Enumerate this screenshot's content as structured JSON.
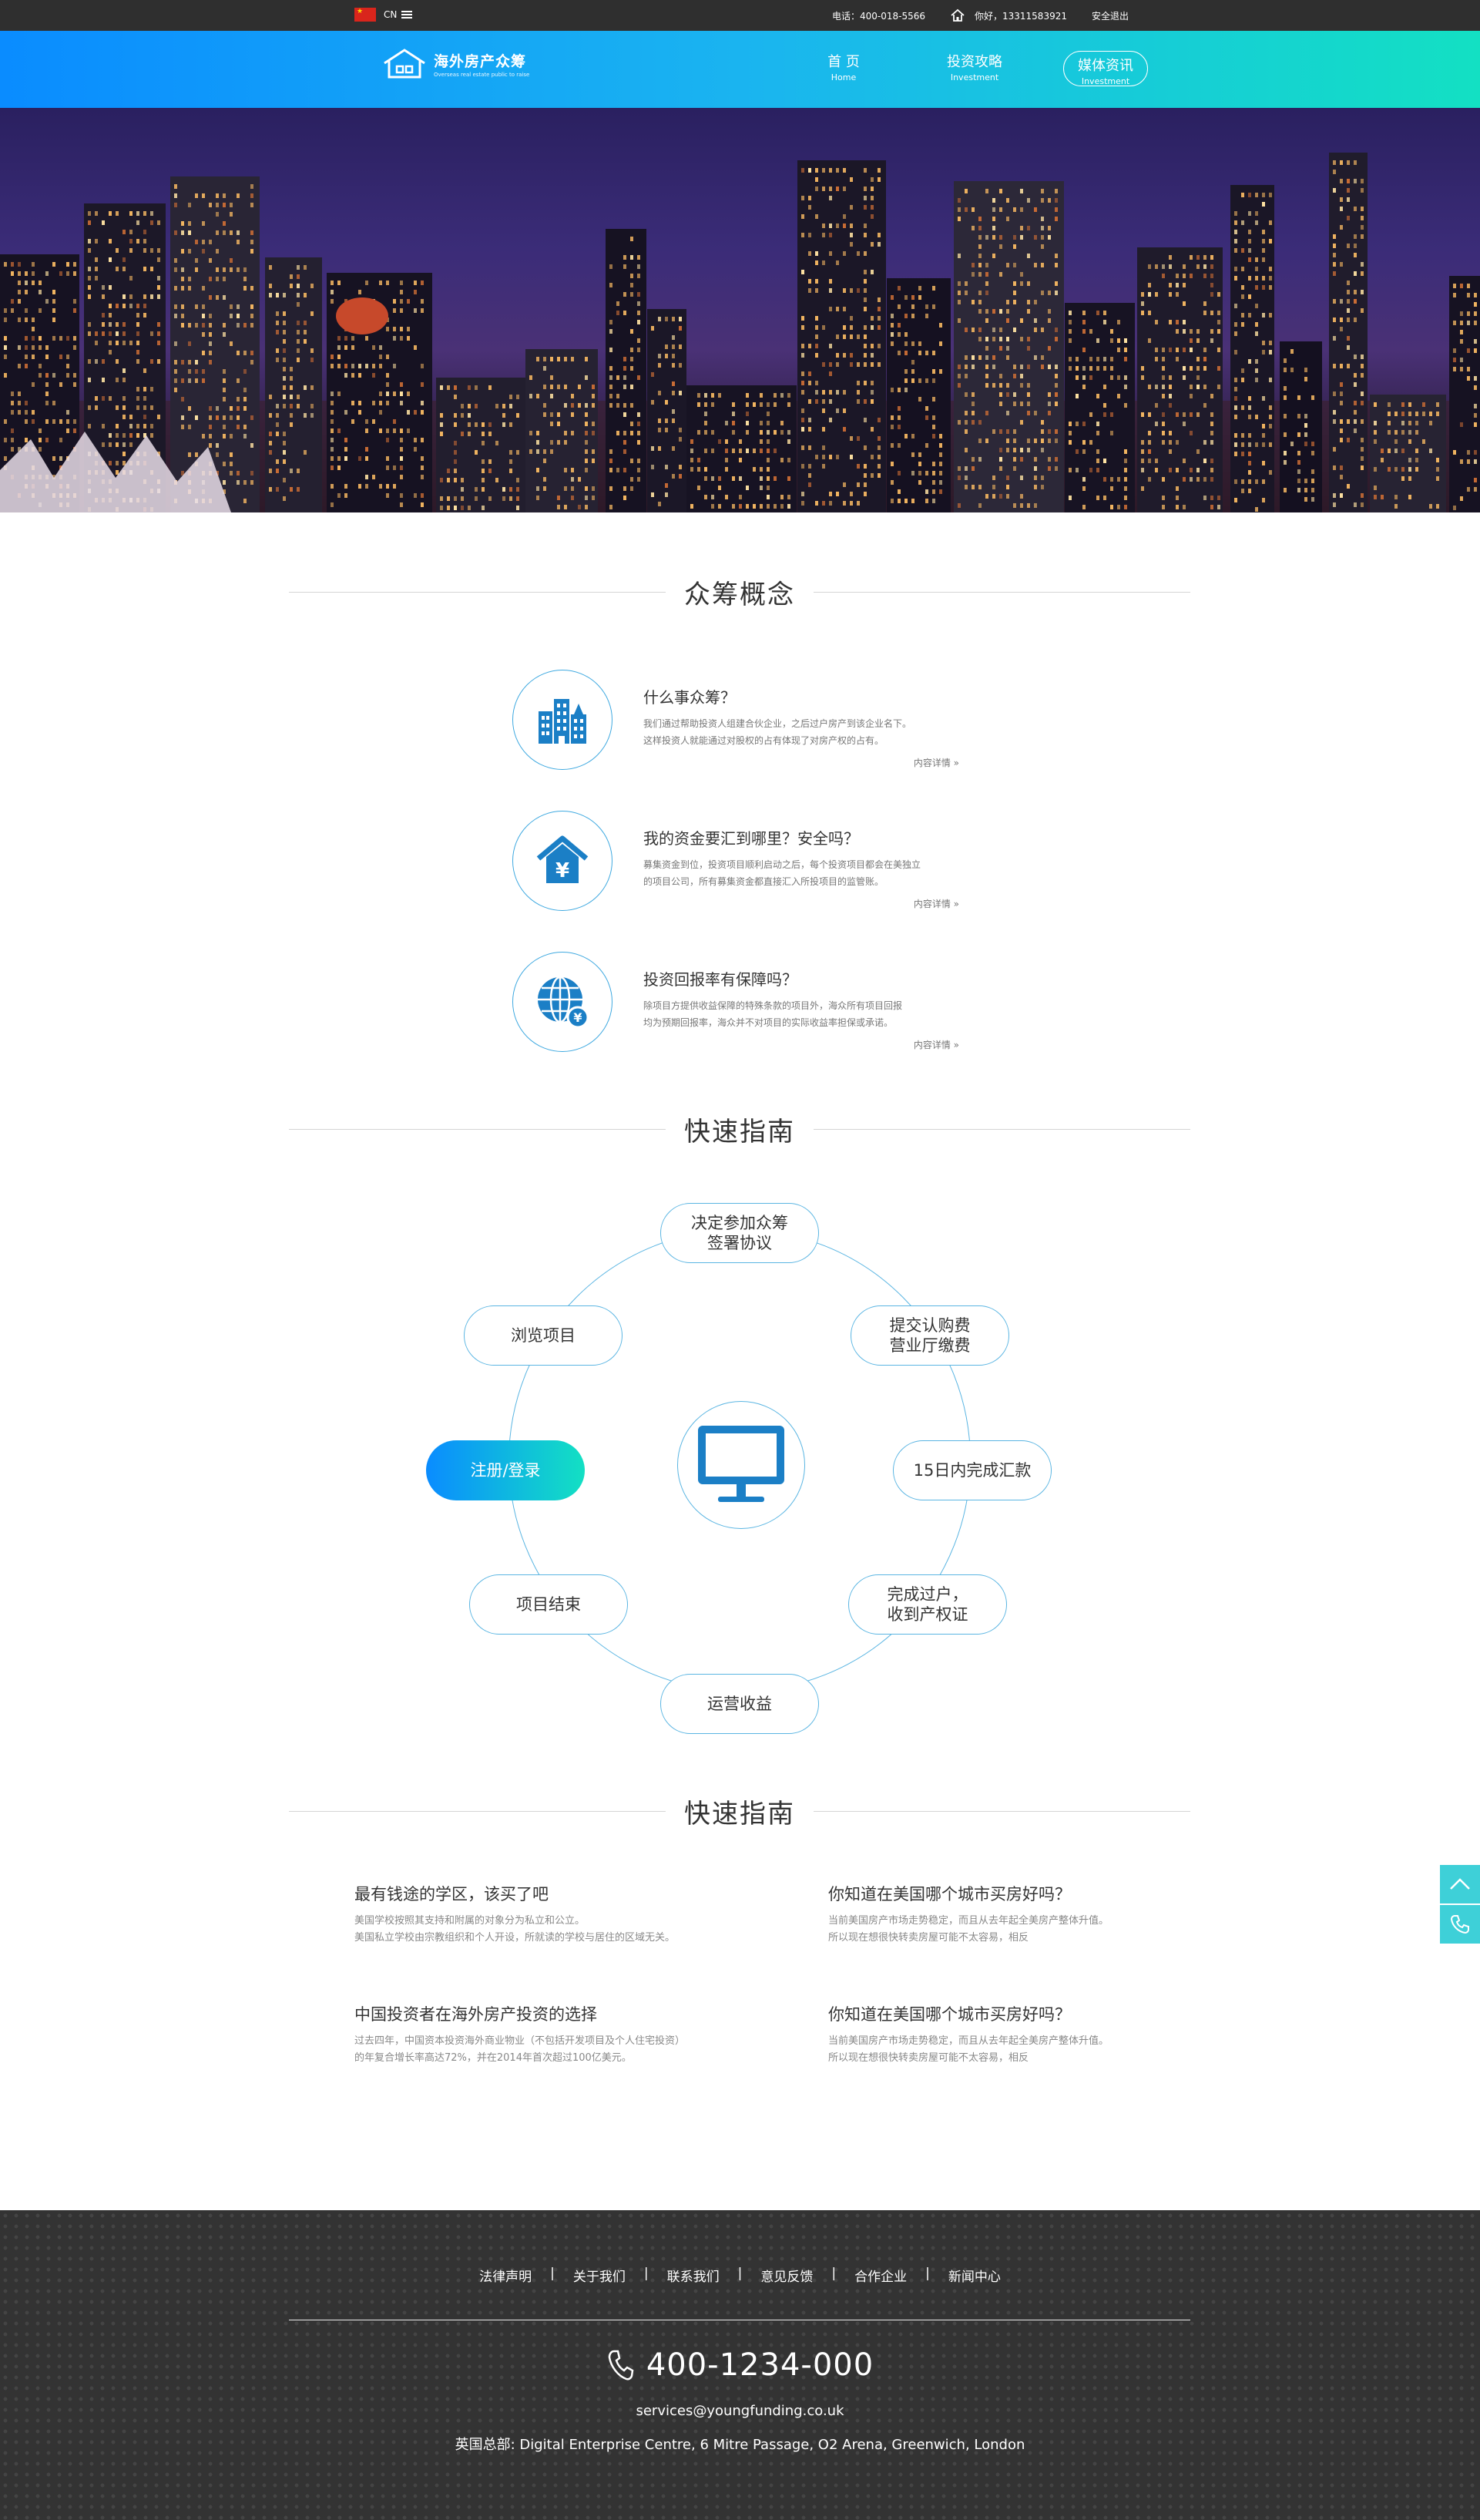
{
  "topbar": {
    "lang": "CN",
    "phone": "电话：400-018-5566",
    "greeting": "你好，13311583921",
    "logout": "安全退出"
  },
  "nav": {
    "logo_cn": "海外房产众筹",
    "logo_en": "Overseas real estate public to raise",
    "items": [
      {
        "cn": "首 页",
        "en": "Home"
      },
      {
        "cn": "投资攻略",
        "en": "Investment"
      },
      {
        "cn": "媒体资讯",
        "en": "Investment"
      }
    ]
  },
  "concept": {
    "title": "众筹概念",
    "items": [
      {
        "icon": "city-buildings-icon",
        "title": "什么事众筹？",
        "line1": "我们通过帮助投资人组建合伙企业，之后过户房产到该企业名下。",
        "line2": "这样投资人就能通过对股权的占有体现了对房产权的占有。",
        "more": "内容详情"
      },
      {
        "icon": "yuan-house-icon",
        "title": "我的资金要汇到哪里？安全吗？",
        "line1": "募集资金到位，投资项目顺利启动之后，每个投资项目都会在美独立",
        "line2": "的项目公司，所有募集资金都直接汇入所投项目的监管账。",
        "more": "内容详情"
      },
      {
        "icon": "globe-yuan-icon",
        "title": "投资回报率有保障吗？",
        "line1": "除项目方提供收益保障的特殊条款的项目外，海众所有项目回报",
        "line2": "均为预期回报率，海众并不对项目的实际收益率担保或承诺。",
        "more": "内容详情"
      }
    ]
  },
  "guide": {
    "title": "快速指南",
    "center_icon": "monitor-icon",
    "steps": [
      {
        "l1": "决定参加众筹",
        "l2": "签署协议"
      },
      {
        "l1": "提交认购费",
        "l2": "营业厅缴费"
      },
      {
        "l1": "15日内完成汇款",
        "l2": ""
      },
      {
        "l1": "完成过户，",
        "l2": "收到产权证"
      },
      {
        "l1": "运营收益",
        "l2": ""
      },
      {
        "l1": "项目结束",
        "l2": ""
      },
      {
        "l1": "注册/登录",
        "l2": ""
      },
      {
        "l1": "浏览项目",
        "l2": ""
      }
    ]
  },
  "news": {
    "title": "快速指南",
    "items": [
      {
        "title": "最有钱途的学区，该买了吧",
        "line1": "美国学校按照其支持和附属的对象分为私立和公立。",
        "line2": "美国私立学校由宗教组织和个人开设，所就读的学校与居住的区域无关。"
      },
      {
        "title": "你知道在美国哪个城市买房好吗？",
        "line1": "当前美国房产市场走势稳定，而且从去年起全美房产整体升值。",
        "line2": "所以现在想很快转卖房屋可能不太容易，相反"
      },
      {
        "title": "中国投资者在海外房产投资的选择",
        "line1": "过去四年，中国资本投资海外商业物业（不包括开发项目及个人住宅投资）",
        "line2": "的年复合增长率高达72%，并在2014年首次超过100亿美元。"
      },
      {
        "title": "你知道在美国哪个城市买房好吗？",
        "line1": "当前美国房产市场走势稳定，而且从去年起全美房产整体升值。",
        "line2": "所以现在想很快转卖房屋可能不太容易，相反"
      }
    ]
  },
  "footer": {
    "links": [
      "法律声明",
      "关于我们",
      "联系我们",
      "意见反馈",
      "合作企业",
      "新闻中心"
    ],
    "separator": "|",
    "phone": "400-1234-000",
    "email": "services@youngfunding.co.uk",
    "address": "英国总部: Digital Enterprise Centre, 6 Mitre Passage, O2 Arena, Greenwich, London"
  },
  "side": {
    "icons": [
      "chevron-up-icon",
      "phone-icon"
    ]
  },
  "colors": {
    "accent_start": "#0a8cff",
    "accent_end": "#13e0c3",
    "ring": "#5ab5e2",
    "icon_blue": "#1b7fc6",
    "footer_bg": "#333333",
    "topbar_bg": "#2f2f2f"
  }
}
